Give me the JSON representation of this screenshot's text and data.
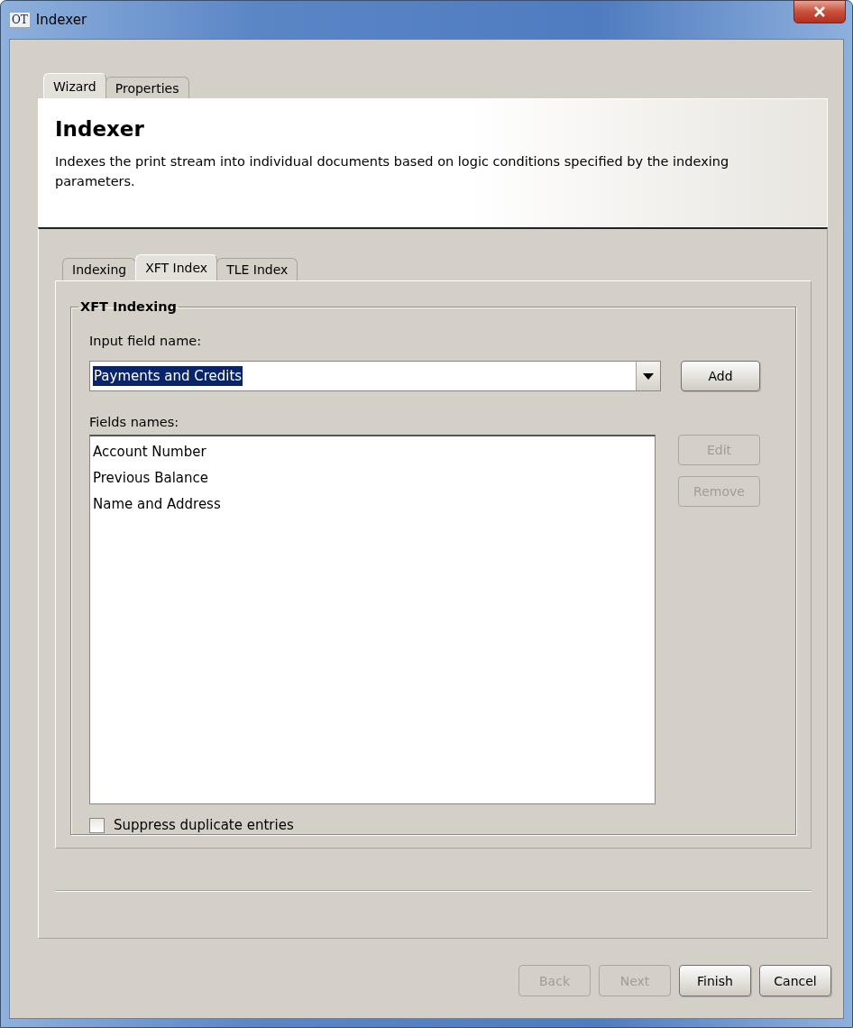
{
  "window": {
    "title": "Indexer",
    "icon_text": "OT"
  },
  "outer_tabs": [
    {
      "label": "Wizard",
      "selected": true
    },
    {
      "label": "Properties",
      "selected": false
    }
  ],
  "header": {
    "title": "Indexer",
    "description": "Indexes the print stream into individual documents based on logic conditions specified by the indexing parameters."
  },
  "inner_tabs": [
    {
      "label": "Indexing",
      "selected": false
    },
    {
      "label": "XFT Index",
      "selected": true
    },
    {
      "label": "TLE Index",
      "selected": false
    }
  ],
  "group": {
    "title": "XFT Indexing"
  },
  "input_field": {
    "label": "Input field name:",
    "value": "Payments and Credits",
    "selected_text": true
  },
  "add_button": {
    "label": "Add",
    "disabled": false
  },
  "fields": {
    "label": "Fields names:",
    "items": [
      "Account Number",
      "Previous Balance",
      "Name and Address"
    ]
  },
  "side_buttons": [
    {
      "label": "Edit",
      "disabled": true
    },
    {
      "label": "Remove",
      "disabled": true
    }
  ],
  "checkbox": {
    "label": "Suppress duplicate entries",
    "checked": false
  },
  "footer_buttons": [
    {
      "label": "Back",
      "disabled": true
    },
    {
      "label": "Next",
      "disabled": true
    },
    {
      "label": "Finish",
      "disabled": false
    },
    {
      "label": "Cancel",
      "disabled": false
    }
  ]
}
